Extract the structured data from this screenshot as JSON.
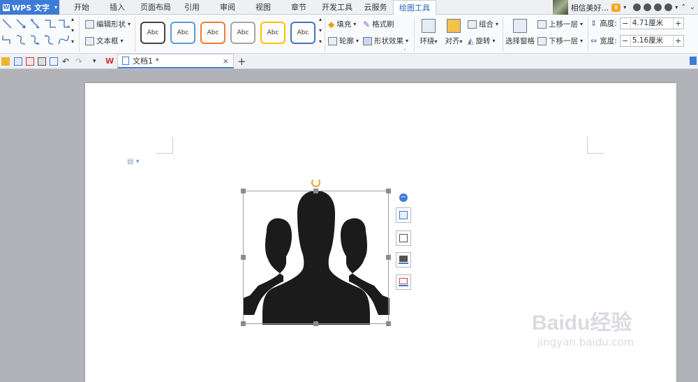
{
  "app": {
    "name": "WPS 文字"
  },
  "menu": {
    "tabs": [
      "开始",
      "插入",
      "页面布局",
      "引用",
      "审阅",
      "视图",
      "章节",
      "开发工具",
      "云服务",
      "绘图工具"
    ],
    "active_tab": "绘图工具"
  },
  "user": {
    "name": "相信美好..."
  },
  "ribbon": {
    "edit_shape": "编辑形状",
    "text_box": "文本框",
    "style_label": "Abc",
    "fill": "填充",
    "format_brush": "格式刷",
    "outline": "轮廓",
    "shape_effect": "形状效果",
    "wrap": "环绕",
    "align": "对齐",
    "group": "组合",
    "rotate": "旋转",
    "select_pane": "选择窗格",
    "bring_forward": "上移一层",
    "send_backward": "下移一层",
    "height_label": "高度:",
    "height_value": "4.71厘米",
    "width_label": "宽度:",
    "width_value": "5.16厘米"
  },
  "doc": {
    "tab_title": "文档1 *"
  },
  "watermark": {
    "brand": "Baidu经验",
    "url": "jingyan.baidu.com"
  },
  "colors": {
    "accent": "#3c7bd6",
    "ribbon_bg": "#f9fafb",
    "workspace_bg": "#b2b3b8",
    "silhouette": "#1b1b1b",
    "style_borders": [
      "#444444",
      "#5b9bd5",
      "#ed7d31",
      "#a5a5a5",
      "#ffc000",
      "#4472c4"
    ]
  }
}
